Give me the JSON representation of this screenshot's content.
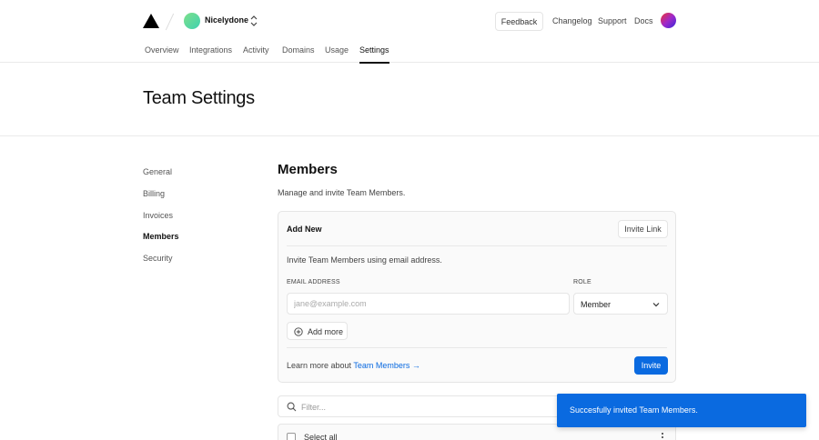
{
  "header": {
    "team_name": "Nicelydone",
    "feedback_label": "Feedback",
    "links": [
      "Changelog",
      "Support",
      "Docs"
    ]
  },
  "tabs": [
    "Overview",
    "Integrations",
    "Activity",
    "Domains",
    "Usage",
    "Settings"
  ],
  "active_tab": "Settings",
  "page_title": "Team Settings",
  "sidenav": [
    "General",
    "Billing",
    "Invoices",
    "Members",
    "Security"
  ],
  "active_sidenav": "Members",
  "members": {
    "title": "Members",
    "description": "Manage and invite Team Members.",
    "card": {
      "title": "Add New",
      "invite_link_label": "Invite Link",
      "subtitle": "Invite Team Members using email address.",
      "email_label": "EMAIL ADDRESS",
      "email_placeholder": "jane@example.com",
      "email_value": "",
      "role_label": "ROLE",
      "role_value": "Member",
      "add_more_label": "Add more",
      "learn_prefix": "Learn more about",
      "learn_link": "Team Members →",
      "invite_label": "Invite"
    },
    "filter_placeholder": "Filter...",
    "select_all_label": "Select all"
  },
  "toast": {
    "message": "Succesfully invited Team Members."
  },
  "colors": {
    "accent": "#0a6ae0",
    "border": "#e5e5e5"
  }
}
